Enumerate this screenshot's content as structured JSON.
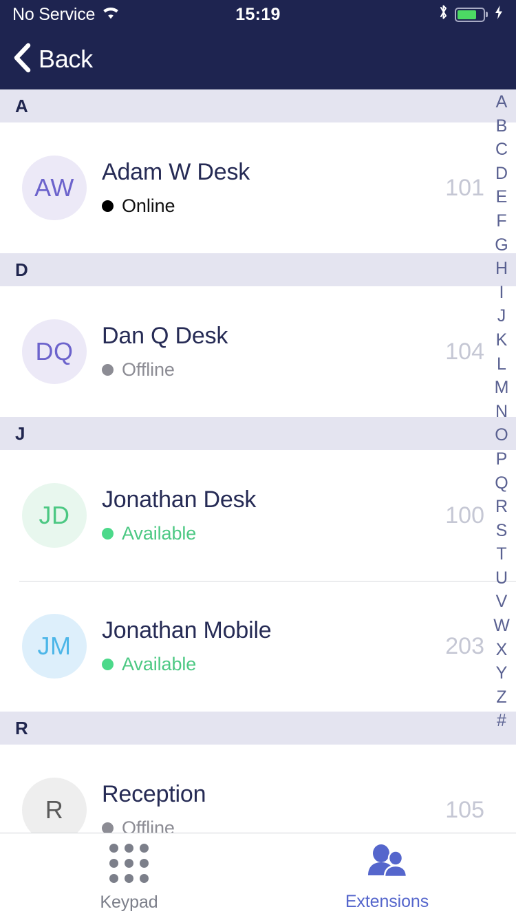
{
  "status_bar": {
    "carrier": "No Service",
    "wifi_icon": "wifi-icon",
    "time": "15:19",
    "bluetooth_icon": "bluetooth-icon",
    "battery_icon": "battery-icon",
    "charging_icon": "charging-bolt-icon",
    "battery_color": "#4cd964"
  },
  "nav": {
    "back_label": "Back",
    "back_icon": "chevron-left-icon",
    "background": "#1e2450"
  },
  "sections": [
    {
      "letter": "A",
      "contacts": [
        {
          "initials": "AW",
          "name": "Adam W Desk",
          "status": "Online",
          "extension": "101",
          "avatar_bg": "#ece9f7",
          "avatar_fg": "#6c63cc",
          "dot_color": "#000000",
          "status_color": "#111111"
        }
      ]
    },
    {
      "letter": "D",
      "contacts": [
        {
          "initials": "DQ",
          "name": "Dan Q Desk",
          "status": "Offline",
          "extension": "104",
          "avatar_bg": "#ece9f7",
          "avatar_fg": "#6c63cc",
          "dot_color": "#8c8c94",
          "status_color": "#8c8c94"
        }
      ]
    },
    {
      "letter": "J",
      "contacts": [
        {
          "initials": "JD",
          "name": "Jonathan Desk",
          "status": "Available",
          "extension": "100",
          "avatar_bg": "#e8f7ee",
          "avatar_fg": "#4cc883",
          "dot_color": "#4cd98a",
          "status_color": "#4cc883"
        },
        {
          "initials": "JM",
          "name": "Jonathan Mobile",
          "status": "Available",
          "extension": "203",
          "avatar_bg": "#ddeffb",
          "avatar_fg": "#4cb6e8",
          "dot_color": "#4cd98a",
          "status_color": "#4cc883"
        }
      ]
    },
    {
      "letter": "R",
      "contacts": [
        {
          "initials": "R",
          "name": "Reception",
          "status": "Offline",
          "extension": "105",
          "avatar_bg": "#eeeeee",
          "avatar_fg": "#5a5a5a",
          "dot_color": "#8c8c94",
          "status_color": "#8c8c94"
        }
      ]
    }
  ],
  "alpha_index": {
    "letters": [
      "A",
      "B",
      "C",
      "D",
      "E",
      "F",
      "G",
      "H",
      "I",
      "J",
      "K",
      "L",
      "M",
      "N",
      "O",
      "P",
      "Q",
      "R",
      "S",
      "T",
      "U",
      "V",
      "W",
      "X",
      "Y",
      "Z",
      "#"
    ],
    "color": "#5a6191"
  },
  "tab_bar": {
    "tabs": [
      {
        "label": "Keypad",
        "icon": "keypad-grid-icon",
        "active": false
      },
      {
        "label": "Extensions",
        "icon": "people-icon",
        "active": true
      }
    ],
    "active_color": "#5566cc",
    "inactive_color": "#7c7f8a"
  }
}
